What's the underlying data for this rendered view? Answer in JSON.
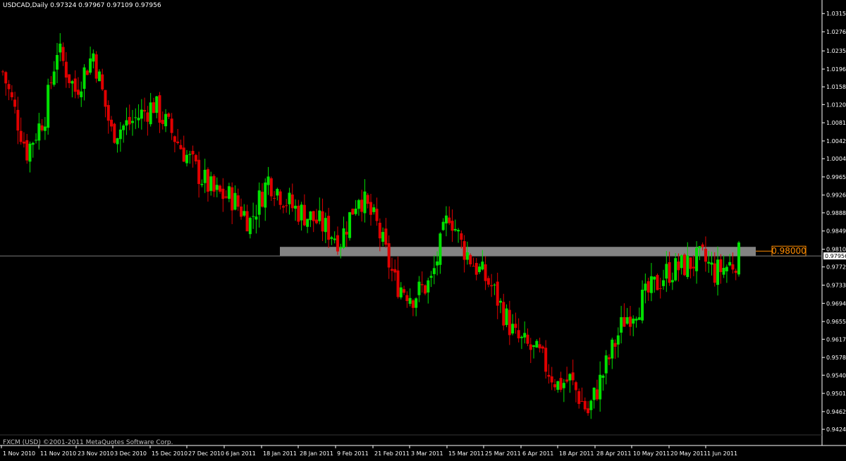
{
  "header": {
    "symbol_line": "USDCAD,Daily  0.97324 0.97967 0.97109 0.97956"
  },
  "footer": {
    "copyright": "FXCM (USD) ©2001-2011 MetaQuotes Software Corp."
  },
  "colors": {
    "background": "#000000",
    "bull": "#00e000",
    "bear": "#e00000",
    "wick_bull": "#00e000",
    "wick_bear": "#e00000",
    "axis": "#ffffff",
    "zone": "#8a8a8a",
    "level_label": "#ff8c00"
  },
  "chart_data": {
    "type": "candlestick",
    "symbol": "USDCAD",
    "timeframe": "Daily",
    "last_ohlc": {
      "open": 0.97324,
      "high": 0.97967,
      "low": 0.97109,
      "close": 0.97956
    },
    "ylim": [
      0.9412,
      1.0335
    ],
    "y_ticks": [
      "1.03150",
      "1.02760",
      "1.02350",
      "1.01960",
      "1.01580",
      "1.01200",
      "1.00810",
      "1.00420",
      "1.00040",
      "0.99650",
      "0.99260",
      "0.98880",
      "0.98490",
      "0.98100",
      "0.97720",
      "0.97330",
      "0.96940",
      "0.96550",
      "0.96170",
      "0.95780",
      "0.95400",
      "0.95010",
      "0.94620",
      "0.94240"
    ],
    "x_labels": [
      "1 Nov 2010",
      "11 Nov 2010",
      "23 Nov 2010",
      "3 Dec 2010",
      "15 Dec 2010",
      "27 Dec 2010",
      "6 Jan 2011",
      "18 Jan 2011",
      "28 Jan 2011",
      "9 Feb 2011",
      "21 Feb 2011",
      "3 Mar 2011",
      "15 Mar 2011",
      "25 Mar 2011",
      "6 Apr 2011",
      "18 Apr 2011",
      "28 Apr 2011",
      "10 May 2011",
      "20 May 2011",
      "1 Jun 2011"
    ],
    "current_price": "0.97956",
    "resistance_zone": {
      "low": 0.9795,
      "high": 0.9815
    },
    "level_label": "0.98000",
    "path_anchors": [
      [
        0,
        1.019
      ],
      [
        8,
        1.002
      ],
      [
        14,
        1.01
      ],
      [
        18,
        1.024
      ],
      [
        24,
        1.015
      ],
      [
        30,
        1.023
      ],
      [
        36,
        1.006
      ],
      [
        42,
        1.008
      ],
      [
        50,
        1.012
      ],
      [
        58,
        1.004
      ],
      [
        64,
        0.998
      ],
      [
        70,
        0.993
      ],
      [
        76,
        0.992
      ],
      [
        82,
        0.987
      ],
      [
        88,
        0.996
      ],
      [
        96,
        0.99
      ],
      [
        104,
        0.987
      ],
      [
        112,
        0.983
      ],
      [
        118,
        0.993
      ],
      [
        124,
        0.986
      ],
      [
        130,
        0.974
      ],
      [
        136,
        0.971
      ],
      [
        142,
        0.974
      ],
      [
        148,
        0.989
      ],
      [
        152,
        0.982
      ],
      [
        156,
        0.978
      ],
      [
        162,
        0.973
      ],
      [
        170,
        0.962
      ],
      [
        178,
        0.958
      ],
      [
        184,
        0.952
      ],
      [
        188,
        0.953
      ],
      [
        194,
        0.946
      ],
      [
        200,
        0.956
      ],
      [
        206,
        0.966
      ],
      [
        212,
        0.97
      ],
      [
        220,
        0.976
      ],
      [
        228,
        0.978
      ],
      [
        232,
        0.979
      ],
      [
        236,
        0.976
      ],
      [
        242,
        0.978
      ],
      [
        244,
        0.9796
      ]
    ]
  }
}
